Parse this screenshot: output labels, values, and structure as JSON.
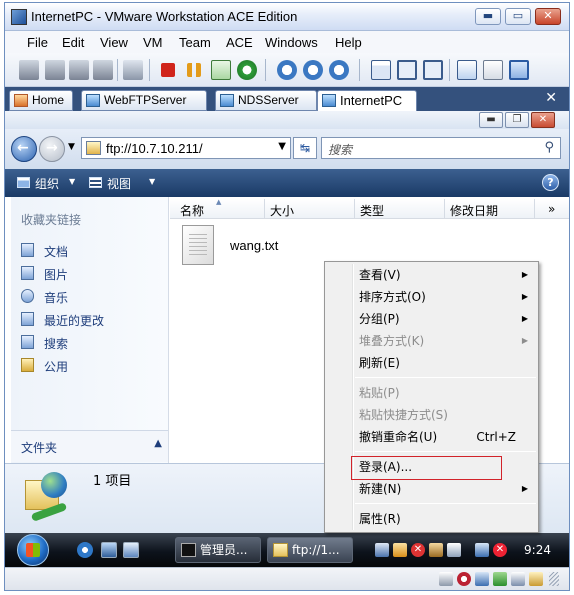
{
  "window": {
    "title": "InternetPC - VMware Workstation ACE Edition",
    "controls": [
      "▬",
      "▭",
      "✕"
    ]
  },
  "menu": [
    "File",
    "Edit",
    "View",
    "VM",
    "Team",
    "ACE",
    "Windows",
    "Help"
  ],
  "tabs": [
    {
      "label": "Home"
    },
    {
      "label": "WebFTPServer"
    },
    {
      "label": "NDSServer"
    },
    {
      "label": "InternetPC"
    }
  ],
  "tab_close": "✕",
  "explorer": {
    "address": "ftp://10.7.10.211/",
    "search_placeholder": "搜索",
    "organize": "组织",
    "views": "视图",
    "help": "?",
    "favorites_header": "收藏夹链接",
    "favorites": [
      "文档",
      "图片",
      "音乐",
      "最近的更改",
      "搜索",
      "公用"
    ],
    "folders_label": "文件夹",
    "columns": [
      "名称",
      "大小",
      "类型",
      "修改日期"
    ],
    "more_columns": "»",
    "file_name": "wang.txt",
    "item_count": "1 项目"
  },
  "context_menu": {
    "view": "查看(V)",
    "sort": "排序方式(O)",
    "group": "分组(P)",
    "stack": "堆叠方式(K)",
    "refresh": "刷新(E)",
    "paste": "粘贴(P)",
    "paste_shortcut": "粘贴快捷方式(S)",
    "undo_rename": "撤销重命名(U)",
    "undo_shortcut": "Ctrl+Z",
    "login": "登录(A)...",
    "new": "新建(N)",
    "properties": "属性(R)"
  },
  "taskbar": {
    "tasks": [
      "管理员...",
      "ftp://1..."
    ],
    "clock": "9:24"
  },
  "colors": {
    "accent": "#1a3a66",
    "highlight": "#d2232a"
  }
}
